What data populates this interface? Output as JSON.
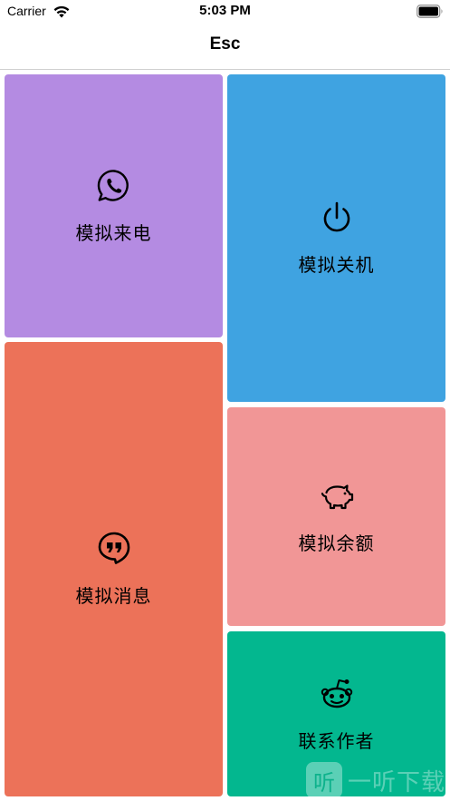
{
  "status_bar": {
    "carrier": "Carrier",
    "time": "5:03 PM"
  },
  "nav": {
    "title": "Esc"
  },
  "tiles": [
    {
      "label": "模拟来电",
      "icon": "phone-bubble-icon",
      "color": "#b48be2"
    },
    {
      "label": "模拟关机",
      "icon": "power-icon",
      "color": "#3fa3e1"
    },
    {
      "label": "模拟消息",
      "icon": "quote-bubble-icon",
      "color": "#ec7259"
    },
    {
      "label": "模拟余额",
      "icon": "piggy-bank-icon",
      "color": "#f19696"
    },
    {
      "label": "联系作者",
      "icon": "reddit-icon",
      "color": "#03b78f"
    }
  ],
  "watermark": {
    "logo": "听",
    "text": "一听下载"
  }
}
